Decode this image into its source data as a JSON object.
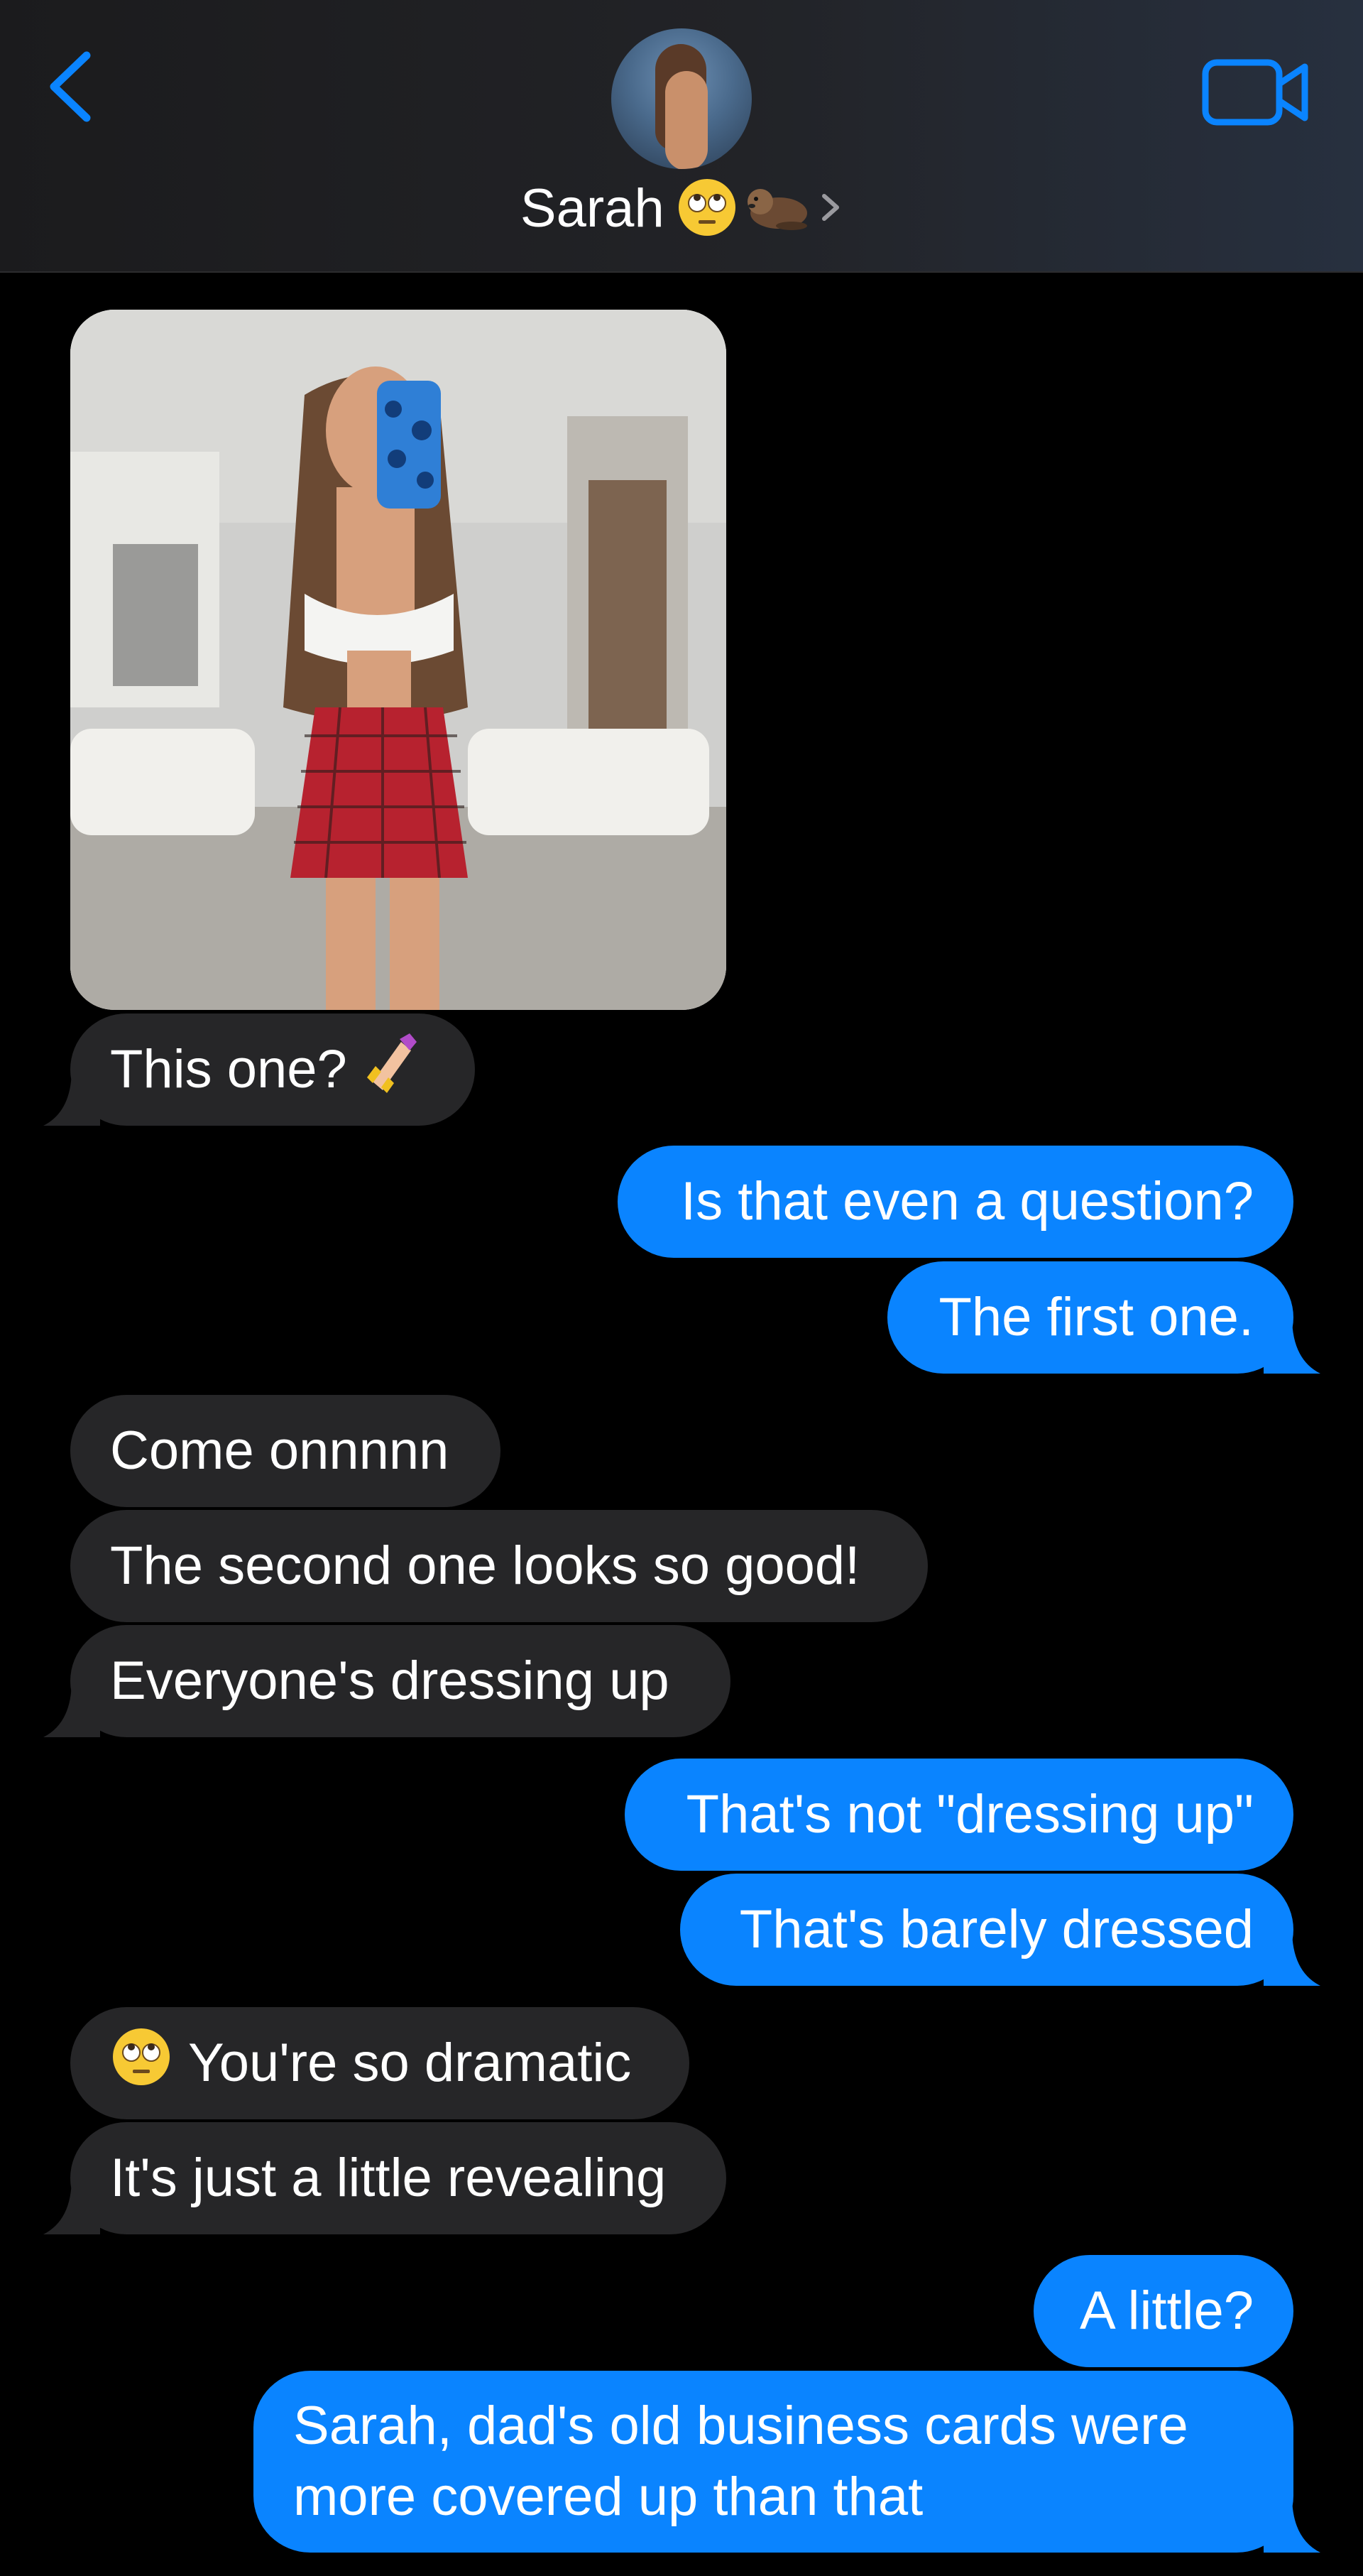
{
  "header": {
    "back_icon": "chevron-left-icon",
    "video_icon": "video-camera-icon",
    "contact_name": "Sarah",
    "contact_emoji_icons": [
      "face-with-rolling-eyes-icon",
      "otter-icon"
    ],
    "accent_color": "#0a84ff"
  },
  "messages": [
    {
      "direction": "incoming",
      "type": "image"
    },
    {
      "direction": "incoming",
      "text": "This one?",
      "emoji_icon": "nail-polish-icon"
    },
    {
      "direction": "outgoing",
      "text": "Is that even a question?"
    },
    {
      "direction": "outgoing",
      "text": "The first one."
    },
    {
      "direction": "incoming",
      "text": "Come onnnnn"
    },
    {
      "direction": "incoming",
      "text": "The second one looks so good!"
    },
    {
      "direction": "incoming",
      "text": "Everyone's dressing up"
    },
    {
      "direction": "outgoing",
      "text": "That's not \"dressing up\""
    },
    {
      "direction": "outgoing",
      "text": "That's barely dressed"
    },
    {
      "direction": "incoming",
      "text": "You're so dramatic",
      "emoji_icon": "face-with-rolling-eyes-icon"
    },
    {
      "direction": "incoming",
      "text": "It's just a little revealing"
    },
    {
      "direction": "outgoing",
      "text": "A little?"
    },
    {
      "direction": "outgoing",
      "text": "Sarah, dad's old business cards were more covered up than that"
    }
  ],
  "colors": {
    "incoming_bubble": "#262628",
    "outgoing_bubble": "#0a84ff",
    "background": "#000000"
  }
}
